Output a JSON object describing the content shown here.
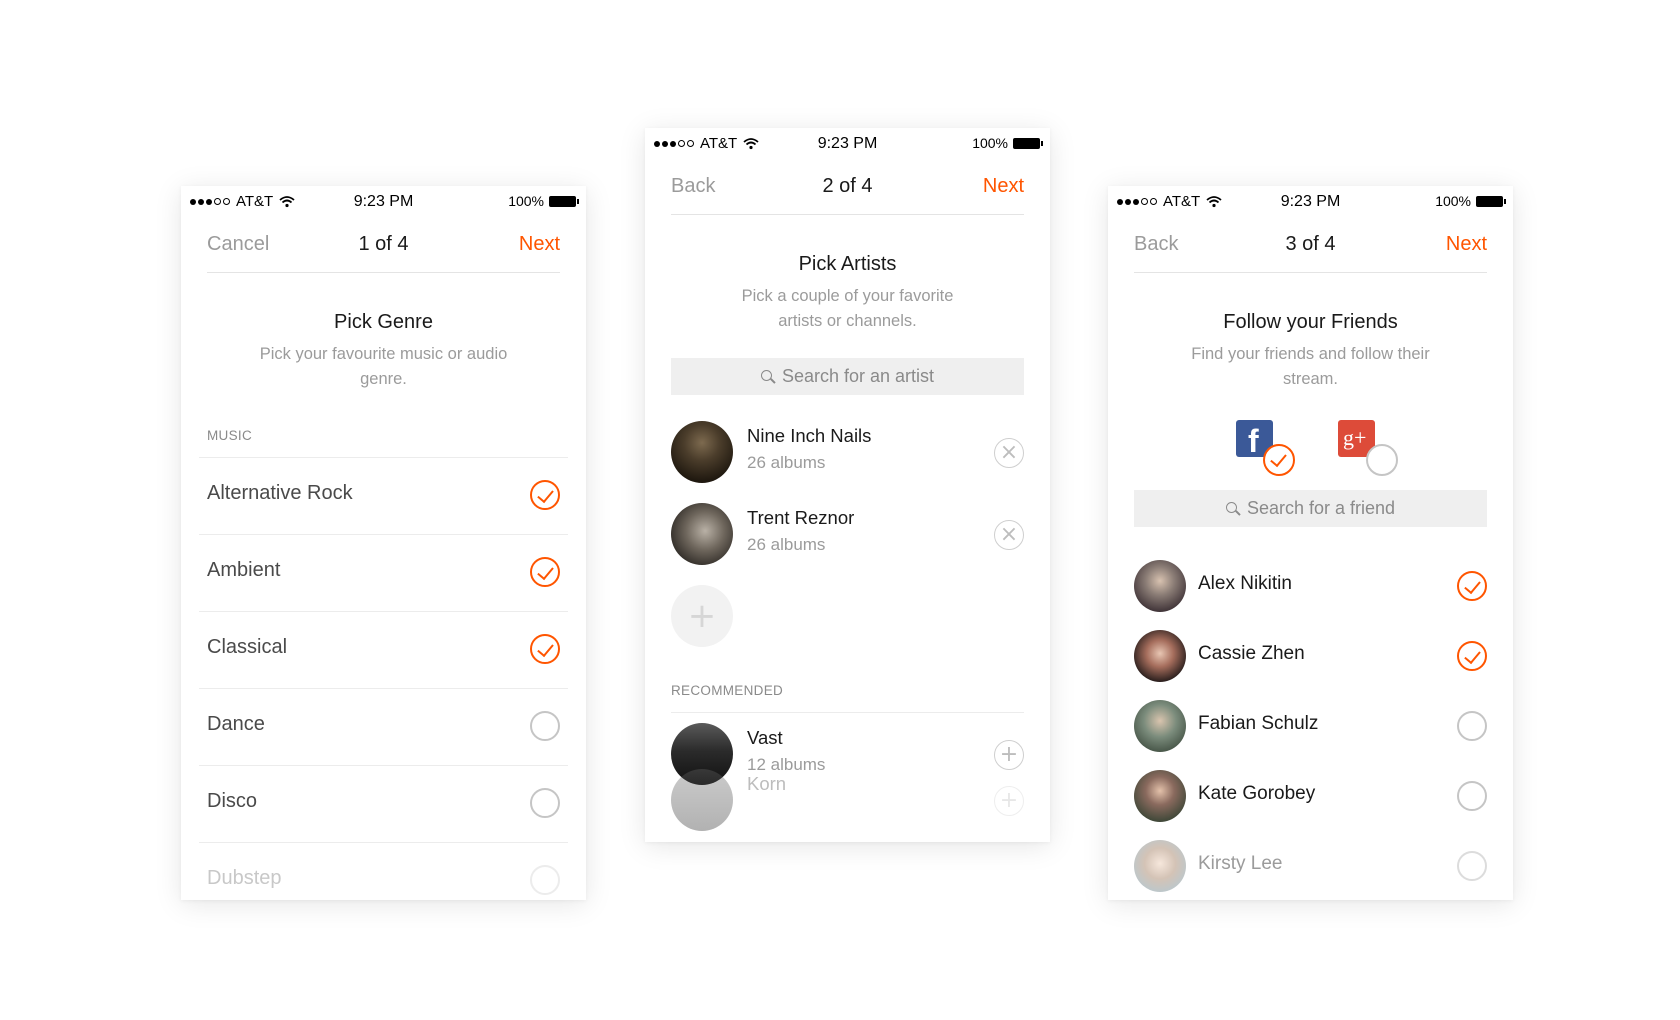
{
  "status": {
    "carrier": "AT&T",
    "time": "9:23 PM",
    "battery": "100%"
  },
  "screen1": {
    "nav": {
      "left": "Cancel",
      "title": "1 of 4",
      "right": "Next"
    },
    "heading": "Pick Genre",
    "subtitle": "Pick your favourite music or audio genre.",
    "section": "MUSIC",
    "genres": [
      {
        "label": "Alternative Rock",
        "checked": true
      },
      {
        "label": "Ambient",
        "checked": true
      },
      {
        "label": "Classical",
        "checked": true
      },
      {
        "label": "Dance",
        "checked": false
      },
      {
        "label": "Disco",
        "checked": false
      },
      {
        "label": "Dubstep",
        "checked": false
      }
    ]
  },
  "screen2": {
    "nav": {
      "left": "Back",
      "title": "2 of 4",
      "right": "Next"
    },
    "heading": "Pick Artists",
    "subtitle": "Pick a couple of your favorite artists or channels.",
    "search_placeholder": "Search for an artist",
    "selected": [
      {
        "name": "Nine Inch Nails",
        "sub": "26 albums"
      },
      {
        "name": "Trent Reznor",
        "sub": "26 albums"
      }
    ],
    "recommended_label": "RECOMMENDED",
    "recommended": [
      {
        "name": "Vast",
        "sub": "12 albums"
      },
      {
        "name": "Korn",
        "sub": ""
      }
    ]
  },
  "screen3": {
    "nav": {
      "left": "Back",
      "title": "3 of 4",
      "right": "Next"
    },
    "heading": "Follow your Friends",
    "subtitle": "Find your friends and follow their stream.",
    "facebook_connected": true,
    "google_connected": false,
    "search_placeholder": "Search for a friend",
    "friends": [
      {
        "name": "Alex Nikitin",
        "followed": true
      },
      {
        "name": "Cassie Zhen",
        "followed": true
      },
      {
        "name": "Fabian Schulz",
        "followed": false
      },
      {
        "name": "Kate Gorobey",
        "followed": false
      },
      {
        "name": "Kirsty Lee",
        "followed": false
      }
    ]
  },
  "colors": {
    "accent": "#ff5500",
    "muted": "#9b9b9b",
    "search_bg": "#efefef"
  },
  "icons": [
    "wifi-icon",
    "battery-icon",
    "check-icon",
    "remove-icon",
    "add-icon",
    "search-icon",
    "facebook-icon",
    "google-plus-icon"
  ]
}
